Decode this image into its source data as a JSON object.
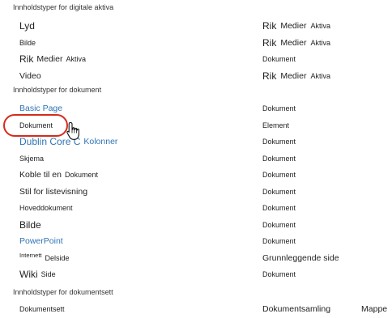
{
  "sections": [
    {
      "header": "Innholdstyper for digitale aktiva",
      "rows": [
        {
          "name": [
            "Lyd"
          ],
          "name_sizes": [
            "big"
          ],
          "parent": [
            "Rik",
            "Medier",
            "Aktiva"
          ],
          "parent_sizes": [
            "big",
            "mid",
            "small"
          ]
        },
        {
          "name": [
            "Bilde"
          ],
          "name_sizes": [
            "small"
          ],
          "parent": [
            "Rik",
            "Medier",
            "Aktiva"
          ],
          "parent_sizes": [
            "big",
            "mid",
            "small"
          ]
        },
        {
          "name": [
            "Rik",
            "Medier",
            "Aktiva"
          ],
          "name_sizes": [
            "big",
            "mid",
            "small"
          ],
          "parent": [
            "Dokument"
          ],
          "parent_sizes": [
            "small"
          ]
        },
        {
          "name": [
            "Video"
          ],
          "name_sizes": [
            "mid"
          ],
          "parent": [
            "Rik",
            "Medier",
            "Aktiva"
          ],
          "parent_sizes": [
            "big",
            "mid",
            "small"
          ]
        }
      ]
    },
    {
      "header": "Innholdstyper for dokument",
      "rows": [
        {
          "name": [
            "Basic Page"
          ],
          "name_sizes": [
            "mid"
          ],
          "link": true,
          "parent": [
            "Dokument"
          ],
          "parent_sizes": [
            "small"
          ]
        },
        {
          "name": [
            "Dokument"
          ],
          "name_sizes": [
            "small"
          ],
          "parent": [
            "Element"
          ],
          "parent_sizes": [
            "small"
          ],
          "highlighted": true
        },
        {
          "name": [
            "Dublin Core C",
            "Kolonner"
          ],
          "name_sizes": [
            "big",
            "mid"
          ],
          "link": true,
          "parent": [
            "Dokument"
          ],
          "parent_sizes": [
            "small"
          ]
        },
        {
          "name": [
            "Skjema"
          ],
          "name_sizes": [
            "small"
          ],
          "parent": [
            "Dokument"
          ],
          "parent_sizes": [
            "small"
          ]
        },
        {
          "name": [
            "Koble til en",
            "Dokument"
          ],
          "name_sizes": [
            "mid",
            "small"
          ],
          "parent": [
            "Dokument"
          ],
          "parent_sizes": [
            "small"
          ]
        },
        {
          "name": [
            "Stil for listevisning"
          ],
          "name_sizes": [
            "mid"
          ],
          "parent": [
            "Dokument"
          ],
          "parent_sizes": [
            "small"
          ]
        },
        {
          "name": [
            "Hoveddokument"
          ],
          "name_sizes": [
            "small"
          ],
          "parent": [
            "Dokument"
          ],
          "parent_sizes": [
            "small"
          ]
        },
        {
          "name": [
            "Bilde"
          ],
          "name_sizes": [
            "big"
          ],
          "parent": [
            "Dokument"
          ],
          "parent_sizes": [
            "small"
          ]
        },
        {
          "name": [
            "PowerPoint"
          ],
          "name_sizes": [
            "mid"
          ],
          "link": true,
          "parent": [
            "Dokument"
          ],
          "parent_sizes": [
            "small"
          ]
        },
        {
          "name": [
            "Internett",
            "Delside"
          ],
          "name_sizes": [
            "tiny",
            "small"
          ],
          "parent": [
            "Grunnleggende side"
          ],
          "parent_sizes": [
            "mid"
          ]
        },
        {
          "name": [
            "Wiki",
            "Side"
          ],
          "name_sizes": [
            "big",
            "small"
          ],
          "parent": [
            "Dokument"
          ],
          "parent_sizes": [
            "small"
          ]
        }
      ]
    },
    {
      "header": "Innholdstyper for dokumentsett",
      "rows": [
        {
          "name": [
            "Dokumentsett"
          ],
          "name_sizes": [
            "small"
          ],
          "parent": [
            "Dokumentsamling",
            "Mappe"
          ],
          "parent_sizes": [
            "mid",
            "mid"
          ],
          "parent_gap": "wide"
        }
      ]
    }
  ],
  "colors": {
    "link": "#2f74b5",
    "highlight": "#d52b1e",
    "text": "#222222"
  },
  "cursor_icon": "hand-pointer-icon"
}
